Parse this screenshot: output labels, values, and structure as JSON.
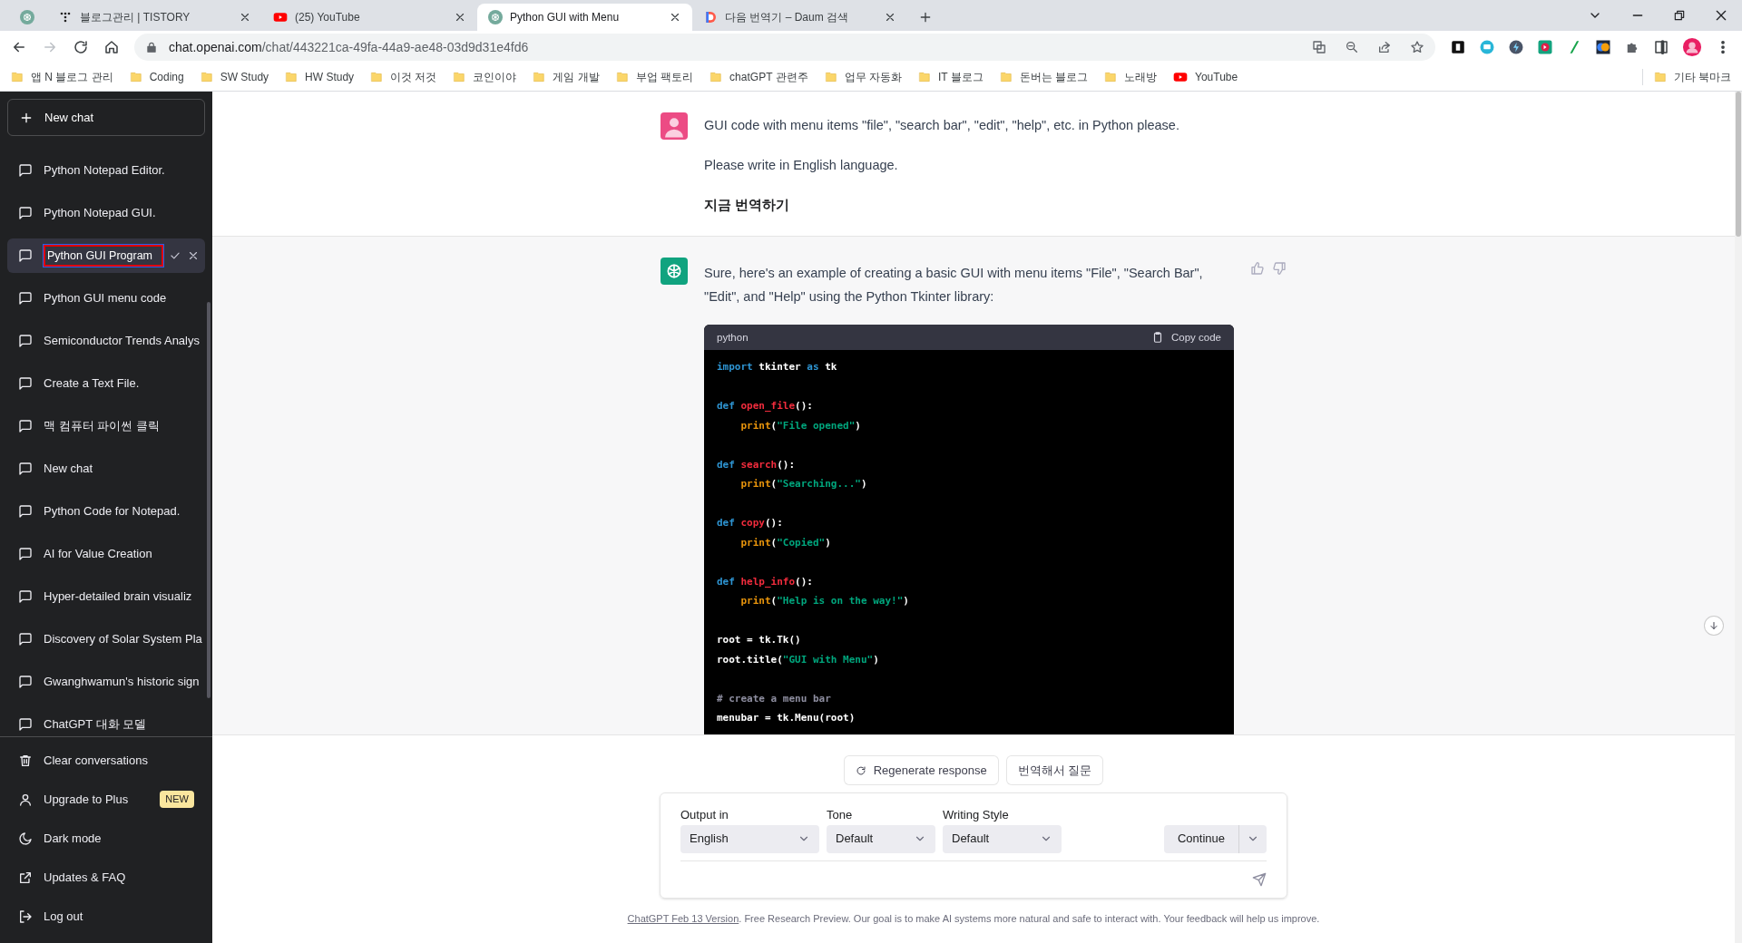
{
  "browser": {
    "tabs": [
      {
        "kind": "pinned",
        "selected": false
      },
      {
        "kind": "page",
        "title": "블로그관리 | TISTORY",
        "selected": false
      },
      {
        "kind": "page",
        "title": "(25) YouTube",
        "selected": false
      },
      {
        "kind": "page",
        "title": "Python GUI with Menu",
        "selected": true
      },
      {
        "kind": "page",
        "title": "다음 번역기 – Daum 검색",
        "selected": false
      }
    ],
    "url_host": "chat.openai.com",
    "url_path": "/chat/443221ca-49fa-44a9-ae48-03d9d31e4fd6",
    "bookmarks": [
      {
        "kind": "folder",
        "label": "앱 N 블로그 관리"
      },
      {
        "kind": "folder",
        "label": "Coding"
      },
      {
        "kind": "folder",
        "label": "SW Study"
      },
      {
        "kind": "folder",
        "label": "HW Study"
      },
      {
        "kind": "folder",
        "label": "이것 저것"
      },
      {
        "kind": "folder",
        "label": "코인이야"
      },
      {
        "kind": "folder",
        "label": "게임 개발"
      },
      {
        "kind": "folder",
        "label": "부업 팩토리"
      },
      {
        "kind": "folder",
        "label": "chatGPT 관련주"
      },
      {
        "kind": "folder",
        "label": "업무 자동화"
      },
      {
        "kind": "folder",
        "label": "IT 블로그"
      },
      {
        "kind": "folder",
        "label": "돈버는 블로그"
      },
      {
        "kind": "folder",
        "label": "노래방"
      },
      {
        "kind": "link",
        "label": "YouTube"
      }
    ],
    "other_bookmarks": "기타 북마크"
  },
  "sidebar": {
    "new_chat": "New chat",
    "chats": [
      {
        "title": "Python Notepad Editor.",
        "editing": false
      },
      {
        "title": "Python Notepad GUI.",
        "editing": false
      },
      {
        "title": "Python GUI Program",
        "editing": true
      },
      {
        "title": "Python GUI menu code",
        "editing": false
      },
      {
        "title": "Semiconductor Trends Analys",
        "editing": false
      },
      {
        "title": "Create a Text File.",
        "editing": false
      },
      {
        "title": "맥 컴퓨터 파이썬 클릭",
        "editing": false
      },
      {
        "title": "New chat",
        "editing": false
      },
      {
        "title": "Python Code for Notepad.",
        "editing": false
      },
      {
        "title": "AI for Value Creation",
        "editing": false
      },
      {
        "title": "Hyper-detailed brain visualiz",
        "editing": false
      },
      {
        "title": "Discovery of Solar System Pla",
        "editing": false
      },
      {
        "title": "Gwanghwamun's historic sign",
        "editing": false
      },
      {
        "title": "ChatGPT 대화 모델",
        "editing": false
      }
    ],
    "menu": [
      {
        "label": "Clear conversations"
      },
      {
        "label": "Upgrade to Plus",
        "badge": "NEW"
      },
      {
        "label": "Dark mode"
      },
      {
        "label": "Updates & FAQ"
      },
      {
        "label": "Log out"
      }
    ]
  },
  "conversation": {
    "user": {
      "paragraphs": [
        {
          "text": "GUI code with menu items \"file\", \"search bar\", \"edit\", \"help\", etc. in Python please.",
          "bold": false
        },
        {
          "text": "Please write in English language.",
          "bold": false
        },
        {
          "text": "지금 번역하기",
          "bold": true
        }
      ]
    },
    "assistant": {
      "intro": "Sure, here's an example of creating a basic GUI with menu items \"File\", \"Search Bar\", \"Edit\", and \"Help\" using the Python Tkinter library:",
      "code": {
        "language": "python",
        "copy_label": "Copy code",
        "blocks": [
          [
            {
              "tokens": [
                {
                  "text": "import",
                  "kind": "keyword"
                },
                {
                  "text": " tkinter ",
                  "kind": "plain"
                },
                {
                  "text": "as",
                  "kind": "keyword"
                },
                {
                  "text": " tk",
                  "kind": "plain"
                }
              ]
            }
          ],
          [
            {
              "tokens": [
                {
                  "text": "def ",
                  "kind": "keyword"
                },
                {
                  "text": "open_file",
                  "kind": "func"
                },
                {
                  "text": "():",
                  "kind": "plain"
                }
              ]
            },
            {
              "tokens": [
                {
                  "text": "    print",
                  "kind": "builtin"
                },
                {
                  "text": "(",
                  "kind": "plain"
                },
                {
                  "text": "\"File opened\"",
                  "kind": "string"
                },
                {
                  "text": ")",
                  "kind": "plain"
                }
              ]
            }
          ],
          [
            {
              "tokens": [
                {
                  "text": "def ",
                  "kind": "keyword"
                },
                {
                  "text": "search",
                  "kind": "func"
                },
                {
                  "text": "():",
                  "kind": "plain"
                }
              ]
            },
            {
              "tokens": [
                {
                  "text": "    print",
                  "kind": "builtin"
                },
                {
                  "text": "(",
                  "kind": "plain"
                },
                {
                  "text": "\"Searching...\"",
                  "kind": "string"
                },
                {
                  "text": ")",
                  "kind": "plain"
                }
              ]
            }
          ],
          [
            {
              "tokens": [
                {
                  "text": "def ",
                  "kind": "keyword"
                },
                {
                  "text": "copy",
                  "kind": "func"
                },
                {
                  "text": "():",
                  "kind": "plain"
                }
              ]
            },
            {
              "tokens": [
                {
                  "text": "    print",
                  "kind": "builtin"
                },
                {
                  "text": "(",
                  "kind": "plain"
                },
                {
                  "text": "\"Copied\"",
                  "kind": "string"
                },
                {
                  "text": ")",
                  "kind": "plain"
                }
              ]
            }
          ],
          [
            {
              "tokens": [
                {
                  "text": "def ",
                  "kind": "keyword"
                },
                {
                  "text": "help_info",
                  "kind": "func"
                },
                {
                  "text": "():",
                  "kind": "plain"
                }
              ]
            },
            {
              "tokens": [
                {
                  "text": "    print",
                  "kind": "builtin"
                },
                {
                  "text": "(",
                  "kind": "plain"
                },
                {
                  "text": "\"Help is on the way!\"",
                  "kind": "string"
                },
                {
                  "text": ")",
                  "kind": "plain"
                }
              ]
            }
          ],
          [
            {
              "tokens": [
                {
                  "text": "root = tk.Tk()",
                  "kind": "plain"
                }
              ]
            },
            {
              "tokens": [
                {
                  "text": "root.title(",
                  "kind": "plain"
                },
                {
                  "text": "\"GUI with Menu\"",
                  "kind": "string"
                },
                {
                  "text": ")",
                  "kind": "plain"
                }
              ]
            }
          ],
          [
            {
              "tokens": [
                {
                  "text": "# create a menu bar",
                  "kind": "comment"
                }
              ]
            },
            {
              "tokens": [
                {
                  "text": "menubar = tk.Menu(root)",
                  "kind": "plain"
                }
              ]
            }
          ]
        ]
      }
    }
  },
  "actions": [
    {
      "kind": "regenerate",
      "label": "Regenerate response"
    },
    {
      "kind": "plain",
      "label": "번역해서 질문"
    }
  ],
  "prompt_panel": {
    "selects": [
      {
        "label": "Output in",
        "value": "English"
      },
      {
        "label": "Tone",
        "value": "Default"
      },
      {
        "label": "Writing Style",
        "value": "Default"
      }
    ],
    "continue": "Continue"
  },
  "footer": {
    "link": "ChatGPT Feb 13 Version",
    "text": ". Free Research Preview. Our goal is to make AI systems more natural and safe to interact with. Your feedback will help us improve."
  }
}
